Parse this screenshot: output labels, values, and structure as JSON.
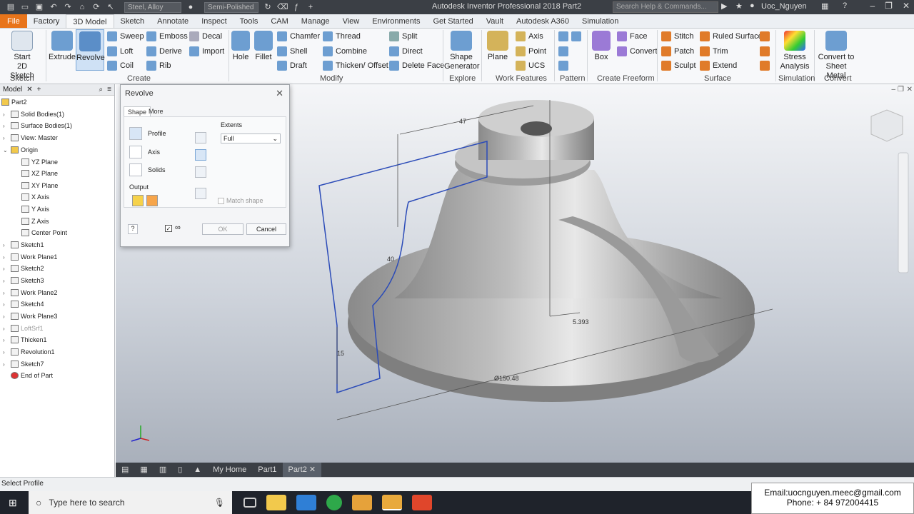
{
  "titlebar": {
    "material": "Steel, Alloy",
    "appearance": "Semi-Polished",
    "title": "Autodesk Inventor Professional 2018    Part2",
    "search_placeholder": "Search Help & Commands...",
    "user": "Uoc_Nguyen"
  },
  "menu_tabs": [
    "File",
    "Factory",
    "3D Model",
    "Sketch",
    "Annotate",
    "Inspect",
    "Tools",
    "CAM",
    "Manage",
    "View",
    "Environments",
    "Get Started",
    "Vault",
    "Autodesk A360",
    "Simulation"
  ],
  "active_tab": "3D Model",
  "ribbon": {
    "start_sketch": "Start\n2D Sketch",
    "extrude": "Extrude",
    "revolve": "Revolve",
    "sweep": "Sweep",
    "emboss": "Emboss",
    "decal": "Decal",
    "loft": "Loft",
    "derive": "Derive",
    "import": "Import",
    "coil": "Coil",
    "rib": "Rib",
    "hole": "Hole",
    "fillet": "Fillet",
    "chamfer": "Chamfer",
    "thread": "Thread",
    "split": "Split",
    "shell": "Shell",
    "combine": "Combine",
    "direct": "Direct",
    "draft": "Draft",
    "thicken": "Thicken/ Offset",
    "delete_face": "Delete Face",
    "shape_generator": "Shape\nGenerator",
    "plane": "Plane",
    "axis": "Axis",
    "point": "Point",
    "ucs": "UCS",
    "box": "Box",
    "face": "Face",
    "convert": "Convert",
    "stitch": "Stitch",
    "ruled_surface": "Ruled Surface",
    "patch": "Patch",
    "trim": "Trim",
    "sculpt": "Sculpt",
    "extend": "Extend",
    "stress": "Stress\nAnalysis",
    "convert_sheet": "Convert to\nSheet Metal",
    "panels": [
      "Sketch",
      "Create",
      "Modify",
      "Explore",
      "Work Features",
      "Pattern",
      "Create Freeform",
      "Surface",
      "Simulation",
      "Convert"
    ]
  },
  "browser": {
    "tab": "Model",
    "nodes": [
      "Part2",
      "Solid Bodies(1)",
      "Surface Bodies(1)",
      "View: Master",
      "Origin",
      "YZ Plane",
      "XZ Plane",
      "XY Plane",
      "X Axis",
      "Y Axis",
      "Z Axis",
      "Center Point",
      "Sketch1",
      "Work Plane1",
      "Sketch2",
      "Sketch3",
      "Work Plane2",
      "Sketch4",
      "Work Plane3",
      "LoftSrf1",
      "Thicken1",
      "Revolution1",
      "Sketch7",
      "End of Part"
    ]
  },
  "dialog": {
    "title": "Revolve",
    "tab_shape": "Shape",
    "tab_more": "More",
    "profile": "Profile",
    "axis": "Axis",
    "solids": "Solids",
    "output": "Output",
    "extents": "Extents",
    "extent_value": "Full",
    "match_shape": "Match shape",
    "ok": "OK",
    "cancel": "Cancel"
  },
  "dimensions": {
    "d1": "47",
    "d2": "40",
    "d3": "15",
    "d4": "5.393",
    "d5": "Ø150.48"
  },
  "docbar": {
    "home": "My Home",
    "tabs": [
      "Part1",
      "Part2"
    ]
  },
  "status": "Select Profile",
  "taskbar": {
    "search": "Type here to search"
  },
  "contact": {
    "email": "Email:uocnguyen.meec@gmail.com",
    "phone": "Phone: + 84 972004415"
  }
}
